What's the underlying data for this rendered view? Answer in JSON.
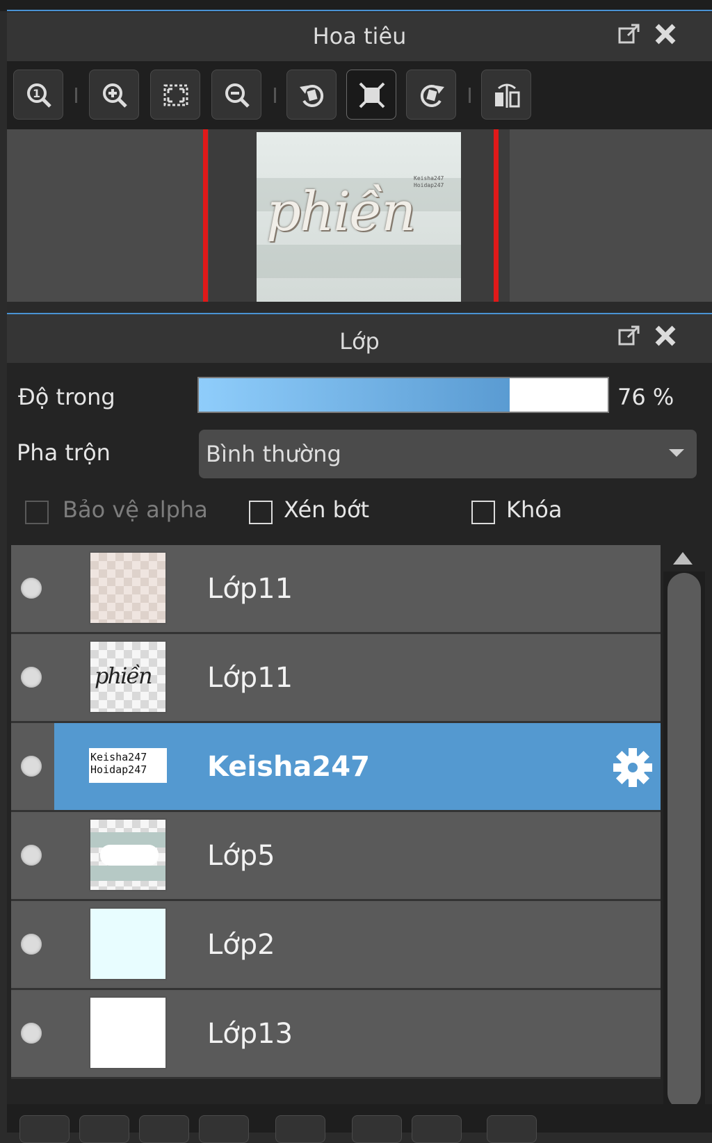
{
  "navigator": {
    "title": "Hoa tiêu",
    "toolbar": [
      {
        "icon": "zoom-actual-icon"
      },
      {
        "icon": "zoom-in-icon"
      },
      {
        "icon": "fit-screen-icon"
      },
      {
        "icon": "zoom-out-icon"
      },
      {
        "icon": "rotate-left-icon"
      },
      {
        "icon": "reset-view-icon"
      },
      {
        "icon": "rotate-right-icon"
      },
      {
        "icon": "flip-horizontal-icon"
      }
    ],
    "preview_word": "phiền",
    "preview_small_text": [
      "Keisha247",
      "Hoidap247"
    ]
  },
  "layers": {
    "title": "Lớp",
    "opacity_label": "Độ trong",
    "opacity_value": 76,
    "opacity_text": "76 %",
    "blend_label": "Pha trộn",
    "blend_value": "Bình thường",
    "checkboxes": {
      "protect_alpha": "Bảo vệ alpha",
      "clipping": "Xén bớt",
      "lock": "Khóa"
    },
    "items": [
      {
        "name": "Lớp11"
      },
      {
        "name": "Lớp11"
      },
      {
        "name": "Keisha247",
        "selected": true,
        "thumb_text": [
          "Keisha247",
          "Hoidap247"
        ]
      },
      {
        "name": "Lớp5"
      },
      {
        "name": "Lớp2"
      },
      {
        "name": "Lớp13"
      }
    ]
  },
  "colors": {
    "accent": "#4a93d4",
    "selected_row": "#5499d0",
    "canvas_guide": "#e01919"
  }
}
